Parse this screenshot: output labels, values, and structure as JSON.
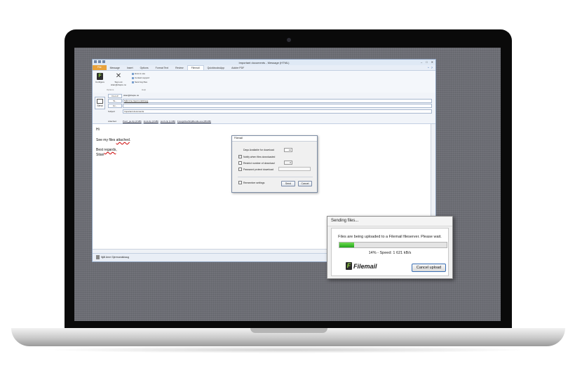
{
  "outlook": {
    "title": "Important documents - Message (HTML)",
    "tabs": [
      "File",
      "Message",
      "Insert",
      "Options",
      "Format Text",
      "Review",
      "Filemail",
      "QuickbooksApp",
      "Adobe PDF"
    ],
    "active_tab": "Filemail",
    "ribbon": {
      "configure": "Configure",
      "signout": "Sign out",
      "signout_user": "stian@drapre.no",
      "howto": "How to use",
      "contact": "Contact support",
      "sendlog": "Send log files",
      "group_options": "Options",
      "group_help": "Help"
    },
    "header": {
      "send": "Send",
      "from_label": "From",
      "from_value": "stian@drapre.no",
      "to_label": "To...",
      "to_value": "Njål Arne Gjermundshaug",
      "cc_label": "Cc...",
      "subject_label": "Subject",
      "subject_value": "Important documents",
      "attached_label": "Attached",
      "attachments": [
        "Pourt_go.zip (4 MB)",
        "Insnt.zip (3 MB)",
        "punh.zip (1 MB)",
        "ForeignDevShipBundle.exe (88 MB)"
      ]
    },
    "body": {
      "line1": "Hi",
      "line2_pre": "See my files ",
      "line2_word": "attached",
      "line2_post": ".",
      "line3_pre": "Best ",
      "line3_word": "regards",
      "line3_post": ",",
      "line4": "Stian"
    },
    "people_pane": "Njål Arne Gjermundshaug"
  },
  "filemail_dialog": {
    "title": "Filemail",
    "days_label": "Days Available for download",
    "days_value": "14",
    "notify_label": "Notify when files downloaded",
    "notify_checked": true,
    "restrict_label": "Restrict number of download",
    "restrict_checked": false,
    "password_label": "Password protect download",
    "password_checked": false,
    "remember_label": "Remember settings",
    "remember_checked": false,
    "send": "Send",
    "cancel": "Cancel"
  },
  "sending_dialog": {
    "title": "Sending files...",
    "message": "Files are being uploaded to a Filemail fileserver. Please wait.",
    "progress_percent": 14,
    "status": "14% - Speed: 1 621 kB/s",
    "logo_text": "Filemail",
    "cancel": "Cancel upload"
  },
  "colors": {
    "progress": "#2ebf23",
    "file_tab": "#e8a23c",
    "screen_bg": "#6c6d74"
  }
}
